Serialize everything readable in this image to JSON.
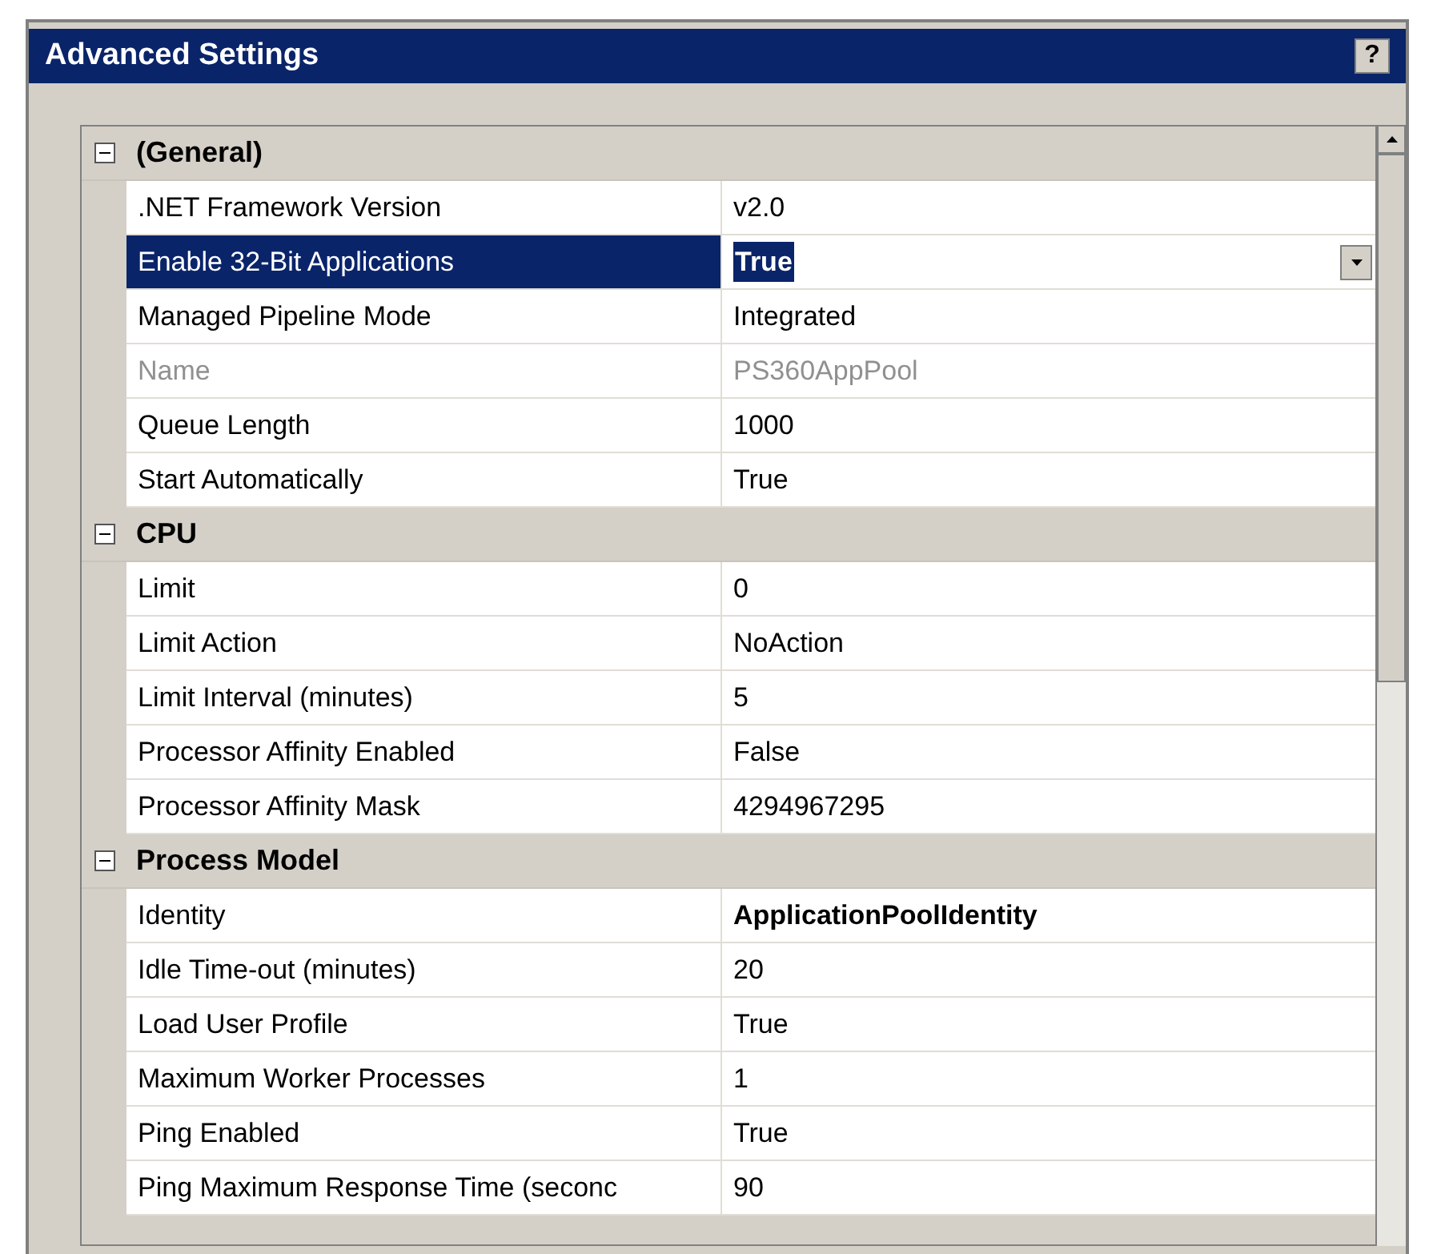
{
  "window": {
    "title": "Advanced Settings",
    "help_button": "?"
  },
  "groups": [
    {
      "label": "(General)",
      "expanded": true,
      "properties": [
        {
          "name": ".NET Framework Version",
          "value": "v2.0",
          "selected": false,
          "disabled": false,
          "bold": false
        },
        {
          "name": "Enable 32-Bit Applications",
          "value": "True",
          "selected": true,
          "disabled": false,
          "bold": true
        },
        {
          "name": "Managed Pipeline Mode",
          "value": "Integrated",
          "selected": false,
          "disabled": false,
          "bold": false
        },
        {
          "name": "Name",
          "value": "PS360AppPool",
          "selected": false,
          "disabled": true,
          "bold": false
        },
        {
          "name": "Queue Length",
          "value": "1000",
          "selected": false,
          "disabled": false,
          "bold": false
        },
        {
          "name": "Start Automatically",
          "value": "True",
          "selected": false,
          "disabled": false,
          "bold": false
        }
      ]
    },
    {
      "label": "CPU",
      "expanded": true,
      "properties": [
        {
          "name": "Limit",
          "value": "0",
          "selected": false,
          "disabled": false,
          "bold": false
        },
        {
          "name": "Limit Action",
          "value": "NoAction",
          "selected": false,
          "disabled": false,
          "bold": false
        },
        {
          "name": "Limit Interval (minutes)",
          "value": "5",
          "selected": false,
          "disabled": false,
          "bold": false
        },
        {
          "name": "Processor Affinity Enabled",
          "value": "False",
          "selected": false,
          "disabled": false,
          "bold": false
        },
        {
          "name": "Processor Affinity Mask",
          "value": "4294967295",
          "selected": false,
          "disabled": false,
          "bold": false
        }
      ]
    },
    {
      "label": "Process Model",
      "expanded": true,
      "properties": [
        {
          "name": "Identity",
          "value": "ApplicationPoolIdentity",
          "selected": false,
          "disabled": false,
          "bold": true
        },
        {
          "name": "Idle Time-out (minutes)",
          "value": "20",
          "selected": false,
          "disabled": false,
          "bold": false
        },
        {
          "name": "Load User Profile",
          "value": "True",
          "selected": false,
          "disabled": false,
          "bold": false
        },
        {
          "name": "Maximum Worker Processes",
          "value": "1",
          "selected": false,
          "disabled": false,
          "bold": false
        },
        {
          "name": "Ping Enabled",
          "value": "True",
          "selected": false,
          "disabled": false,
          "bold": false
        },
        {
          "name": "Ping Maximum Response Time (seconc",
          "value": "90",
          "selected": false,
          "disabled": false,
          "bold": false
        }
      ]
    }
  ]
}
